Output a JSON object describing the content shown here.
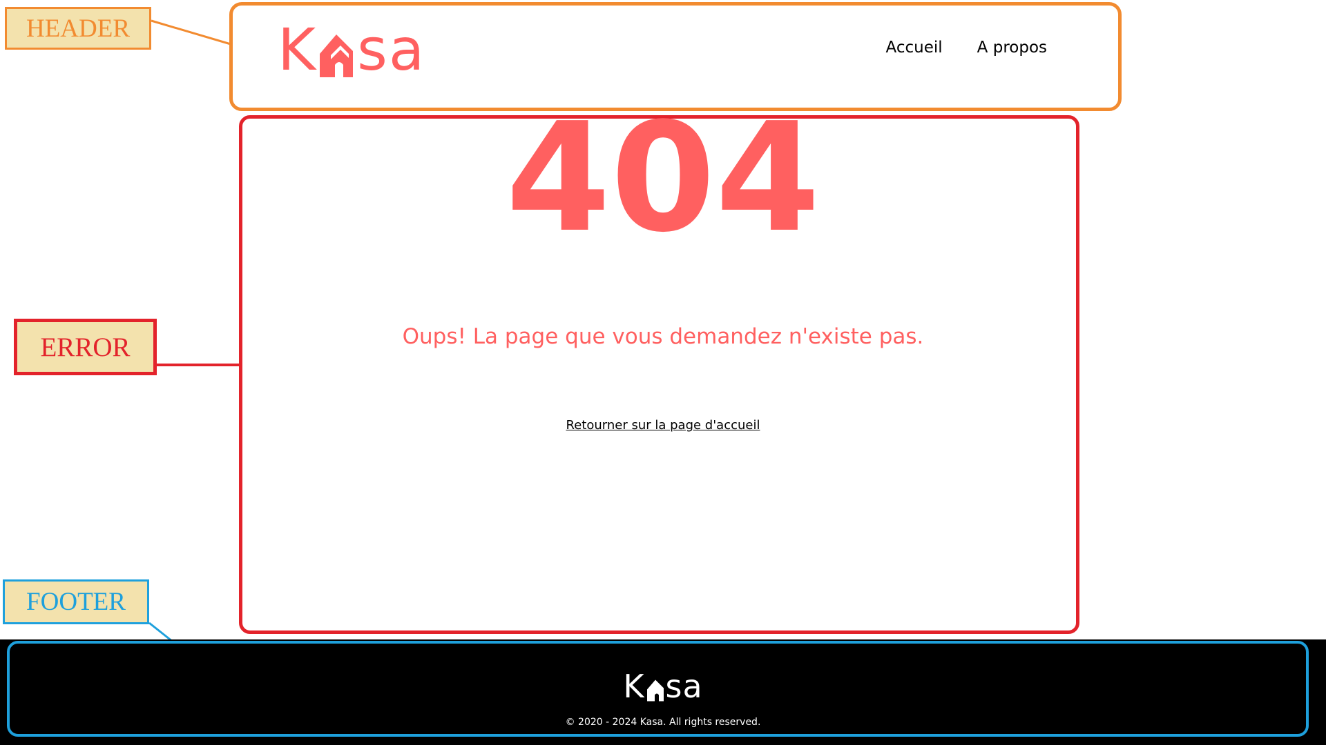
{
  "annotations": {
    "header": "HEADER",
    "error": "ERROR",
    "footer": "FOOTER"
  },
  "header": {
    "logo_first": "K",
    "logo_rest": "sa",
    "nav": [
      "Accueil",
      "A propos"
    ]
  },
  "error": {
    "code": "404",
    "message": "Oups! La page que vous demandez n'existe pas.",
    "link": "Retourner sur la page d'accueil"
  },
  "footer": {
    "logo_first": "K",
    "logo_rest": "sa",
    "copyright": "© 2020 - 2024 Kasa. All rights reserved."
  },
  "colors": {
    "brand": "#ff6060",
    "header_outline": "#f28b30",
    "error_outline": "#e3232b",
    "footer_outline": "#1ea0dc",
    "tag_fill": "#f3e2ad"
  },
  "icons": {
    "logo_glyph": "house-icon"
  }
}
